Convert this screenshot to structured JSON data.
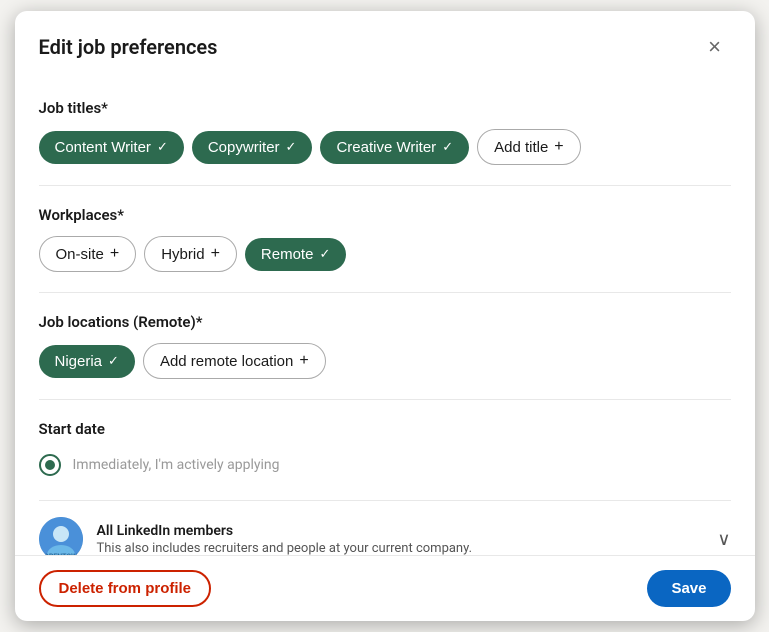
{
  "modal": {
    "title": "Edit job preferences",
    "close_label": "×"
  },
  "job_titles": {
    "label": "Job titles*",
    "tags": [
      {
        "id": "content-writer",
        "text": "Content Writer",
        "selected": true
      },
      {
        "id": "copywriter",
        "text": "Copywriter",
        "selected": true
      },
      {
        "id": "creative-writer",
        "text": "Creative Writer",
        "selected": true
      }
    ],
    "add_label": "Add title"
  },
  "workplaces": {
    "label": "Workplaces*",
    "options": [
      {
        "id": "on-site",
        "text": "On-site",
        "selected": false
      },
      {
        "id": "hybrid",
        "text": "Hybrid",
        "selected": false
      },
      {
        "id": "remote",
        "text": "Remote",
        "selected": true
      }
    ]
  },
  "job_locations": {
    "label": "Job locations (Remote)*",
    "locations": [
      {
        "id": "nigeria",
        "text": "Nigeria",
        "selected": true
      }
    ],
    "add_label": "Add remote location"
  },
  "start_date": {
    "label": "Start date",
    "option": "Immediately, I'm actively applying"
  },
  "visibility": {
    "title": "All LinkedIn members",
    "subtitle": "This also includes recruiters and people at your current company."
  },
  "footer": {
    "delete_label": "Delete from profile",
    "save_label": "Save"
  }
}
